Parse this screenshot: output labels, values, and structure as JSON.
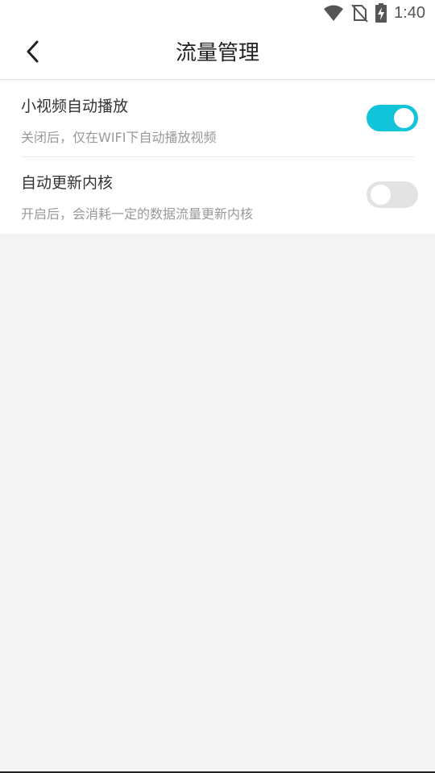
{
  "status_bar": {
    "time": "1:40",
    "icons": [
      "wifi-icon",
      "no-sim-icon",
      "battery-charging-icon"
    ]
  },
  "header": {
    "back_icon": "chevron-left-icon",
    "title": "流量管理"
  },
  "settings": [
    {
      "title": "小视频自动播放",
      "description": "关闭后，仅在WIFI下自动播放视频",
      "enabled": true
    },
    {
      "title": "自动更新内核",
      "description": "开启后，会消耗一定的数据流量更新内核",
      "enabled": false
    }
  ],
  "colors": {
    "toggle_on": "#12c4d9",
    "toggle_off": "#e3e3e3",
    "background": "#f4f4f4"
  }
}
